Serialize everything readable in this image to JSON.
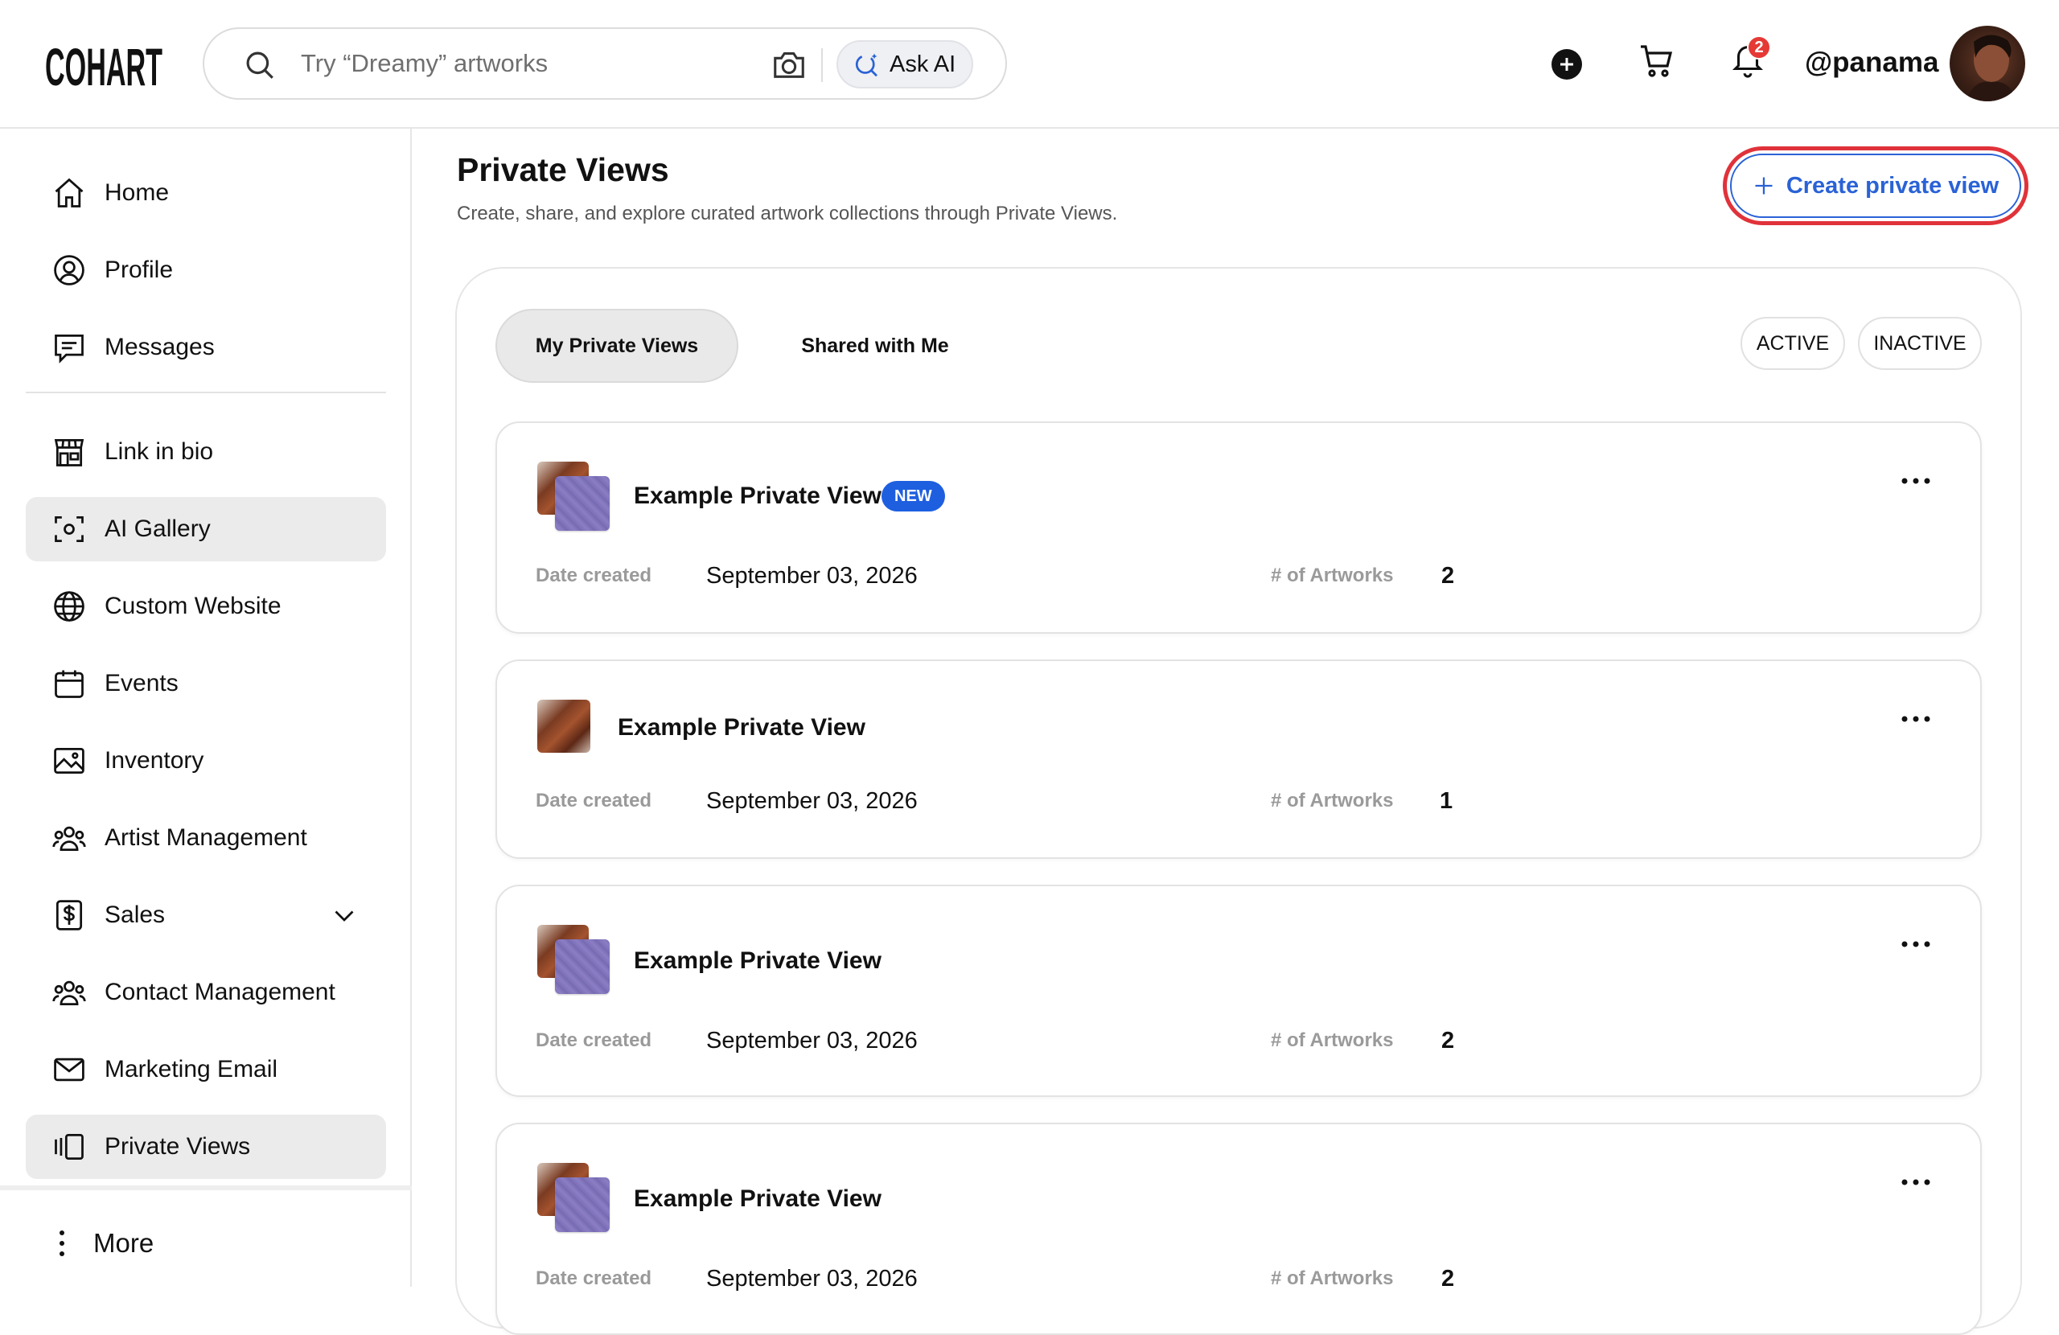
{
  "brand": {
    "logo_text": "COHART"
  },
  "search": {
    "placeholder": "Try “Dreamy” artworks",
    "ask_ai_label": "Ask AI"
  },
  "header": {
    "notification_count": "2",
    "username": "@panama"
  },
  "sidebar": {
    "items": [
      {
        "label": "Home",
        "icon": "home-icon"
      },
      {
        "label": "Profile",
        "icon": "user-circle-icon"
      },
      {
        "label": "Messages",
        "icon": "message-icon"
      },
      {
        "label": "Link in bio",
        "icon": "storefront-icon"
      },
      {
        "label": "AI Gallery",
        "icon": "scan-icon",
        "active": true
      },
      {
        "label": "Custom Website",
        "icon": "globe-icon"
      },
      {
        "label": "Events",
        "icon": "calendar-icon"
      },
      {
        "label": "Inventory",
        "icon": "image-icon"
      },
      {
        "label": "Artist Management",
        "icon": "users-icon"
      },
      {
        "label": "Sales",
        "icon": "dollar-doc-icon",
        "has_dropdown": true
      },
      {
        "label": "Contact Management",
        "icon": "users-icon"
      },
      {
        "label": "Marketing Email",
        "icon": "mail-icon"
      },
      {
        "label": "Private Views",
        "icon": "private-views-icon",
        "active": true
      }
    ],
    "more_label": "More"
  },
  "page": {
    "title": "Private Views",
    "subtitle": "Create, share, and explore curated artwork collections through Private Views.",
    "create_button": "Create private view"
  },
  "tabs": [
    {
      "label": "My Private Views",
      "active": true
    },
    {
      "label": "Shared with Me",
      "active": false
    }
  ],
  "filters": [
    {
      "label": "ACTIVE"
    },
    {
      "label": "INACTIVE"
    }
  ],
  "cards": [
    {
      "name": "Example Private View",
      "badge": "NEW",
      "date_label": "Date created",
      "date": "September 03, 2026",
      "count_label": "# of Artworks",
      "count": "2",
      "thumbs": 2
    },
    {
      "name": "Example Private View",
      "badge": "",
      "date_label": "Date created",
      "date": "September 03, 2026",
      "count_label": "# of Artworks",
      "count": "1",
      "thumbs": 1
    },
    {
      "name": "Example Private View",
      "badge": "",
      "date_label": "Date created",
      "date": "September 03, 2026",
      "count_label": "# of Artworks",
      "count": "2",
      "thumbs": 2
    },
    {
      "name": "Example Private View",
      "badge": "",
      "date_label": "Date created",
      "date": "September 03, 2026",
      "count_label": "# of Artworks",
      "count": "2",
      "thumbs": 2
    }
  ],
  "colors": {
    "accent": "#2a62d6",
    "highlight": "#e0323a",
    "badge": "#e53935"
  }
}
